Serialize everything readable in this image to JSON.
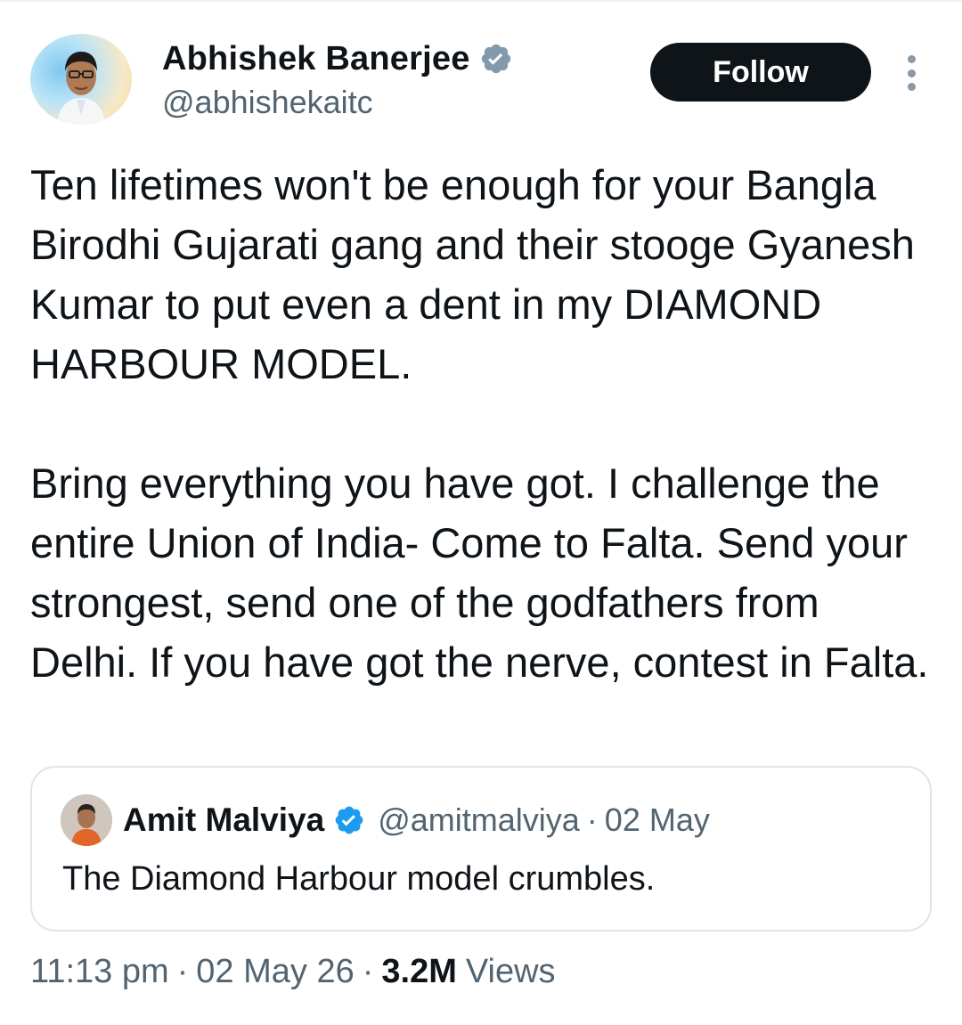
{
  "author": {
    "display_name": "Abhishek Banerjee",
    "handle": "@abhishekaitc",
    "verified": true
  },
  "actions": {
    "follow_label": "Follow",
    "more_icon": "more-vertical-icon"
  },
  "tweet": {
    "paragraphs": [
      "Ten lifetimes won't be enough for your Bangla Birodhi Gujarati gang and their stooge Gyanesh Kumar to put even a dent in my DIAMOND HARBOUR MODEL.",
      "Bring everything you have got. I challenge the entire Union of India- Come to Falta. Send your strongest, send one of the godfathers from Delhi. If you have got the nerve, contest in Falta."
    ]
  },
  "quote": {
    "display_name": "Amit Malviya",
    "handle": "@amitmalviya",
    "separator": "·",
    "date": "02 May",
    "text": "The Diamond Harbour model crumbles.",
    "verified": true
  },
  "meta": {
    "time": "11:13 pm",
    "separator": "·",
    "date": "02 May 26",
    "views_count": "3.2M",
    "views_label": "Views"
  },
  "colors": {
    "verified_badge": "#829aab",
    "quote_verified_badge": "#1d9bf0",
    "follow_bg": "#0f1419",
    "secondary_text": "#536471"
  }
}
